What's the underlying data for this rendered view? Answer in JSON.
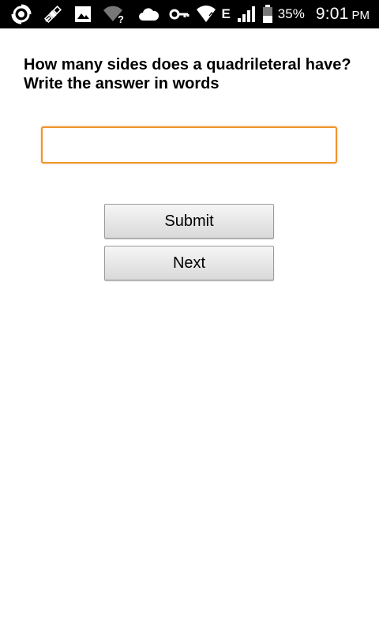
{
  "status_bar": {
    "left_icons": [
      "sync-icon",
      "satellite-icon",
      "image-icon",
      "wifi-question-icon",
      "cloud-icon"
    ],
    "right_icons": [
      "key-icon",
      "wifi-icon",
      "signal-icon",
      "battery-icon"
    ],
    "network_type": "E",
    "battery_percent": "35%",
    "time": "9:01",
    "ampm": "PM"
  },
  "quiz": {
    "question_line1": "How many sides does a quadrileteral have?",
    "question_line2": "Write the answer in words",
    "answer_value": "",
    "answer_placeholder": "",
    "submit_label": "Submit",
    "next_label": "Next"
  },
  "colors": {
    "status_bar_bg": "#000000",
    "input_focus_border": "#f0932b",
    "button_gradient_top": "#f6f6f6",
    "button_gradient_bottom": "#d9d9d9"
  }
}
